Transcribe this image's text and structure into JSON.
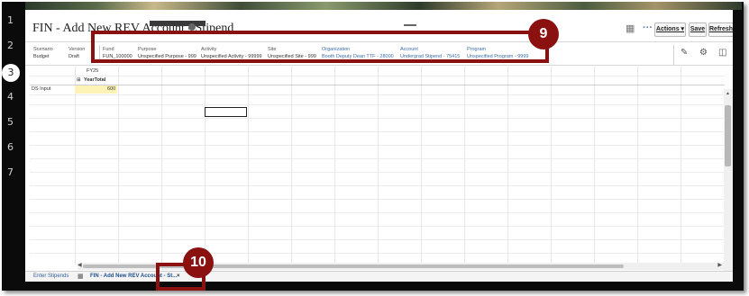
{
  "rail": {
    "numbers": [
      "1",
      "2",
      "3",
      "4",
      "5",
      "6",
      "7"
    ],
    "active": "3"
  },
  "form": {
    "title": "FIN - Add New REV Account - Stipend",
    "toolbar": {
      "actions_label": "Actions ▾",
      "save_label": "Save",
      "refresh_label": "Refresh",
      "more_label": "···"
    }
  },
  "pov": [
    {
      "label": "Scenario",
      "value": "Budget"
    },
    {
      "label": "Version",
      "value": "Draft"
    },
    {
      "label": "Fund",
      "value": "FUN_100000"
    },
    {
      "label": "Purpose",
      "value": "Unspecified Purpose - 999"
    },
    {
      "label": "Activity",
      "value": "Unspecified Activity - 99999"
    },
    {
      "label": "Site",
      "value": "Unspecified Site - 999"
    },
    {
      "label": "Organization",
      "value": "Booth Deputy Dean TTF - 28000"
    },
    {
      "label": "Account",
      "value": "Undergrad Stipend - 75415"
    },
    {
      "label": "Program",
      "value": "Unspecified Program - 9999"
    }
  ],
  "grid": {
    "col_header": "FY25",
    "sub_header": "YearTotal",
    "expand_icon": "⊞",
    "row_label": "DS Input",
    "row_value": "600"
  },
  "tabs": [
    {
      "label": "Enter Stipends"
    },
    {
      "label": "FIN - Add New REV Account - St..."
    }
  ],
  "tab_close": "×",
  "callouts": [
    {
      "number": "9"
    },
    {
      "number": "10"
    }
  ],
  "colors": {
    "callout": "#8b1111",
    "input_cell": "#fdf3b7",
    "link_blue": "#3b6ea8"
  }
}
